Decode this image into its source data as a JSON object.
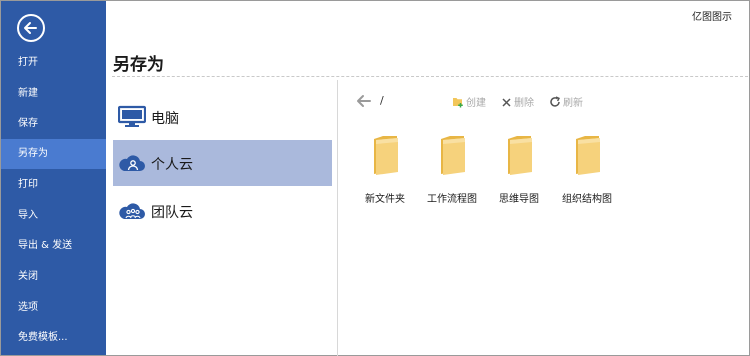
{
  "app": {
    "title": "亿图图示"
  },
  "sidebar": {
    "items": [
      {
        "label": "打开"
      },
      {
        "label": "新建"
      },
      {
        "label": "保存"
      },
      {
        "label": "另存为"
      },
      {
        "label": "打印"
      },
      {
        "label": "导入"
      },
      {
        "label": "导出 & 发送"
      },
      {
        "label": "关闭"
      },
      {
        "label": "选项"
      },
      {
        "label": "免费模板..."
      }
    ],
    "active_item": "另存为",
    "colors": {
      "background": "#2e5aa6",
      "active": "#4a7bd0"
    }
  },
  "page": {
    "title": "另存为"
  },
  "locations": {
    "items": [
      {
        "label": "电脑",
        "icon": "monitor-icon"
      },
      {
        "label": "个人云",
        "icon": "personal-cloud-icon"
      },
      {
        "label": "团队云",
        "icon": "team-cloud-icon"
      }
    ],
    "selected": "个人云",
    "selected_color": "#aab9dc"
  },
  "toolbar": {
    "path": "/",
    "create_label": "创建",
    "delete_label": "删除",
    "refresh_label": "刷新"
  },
  "folders": [
    {
      "name": "新文件夹"
    },
    {
      "name": "工作流程图"
    },
    {
      "name": "思维导图"
    },
    {
      "name": "组织结构图"
    }
  ]
}
